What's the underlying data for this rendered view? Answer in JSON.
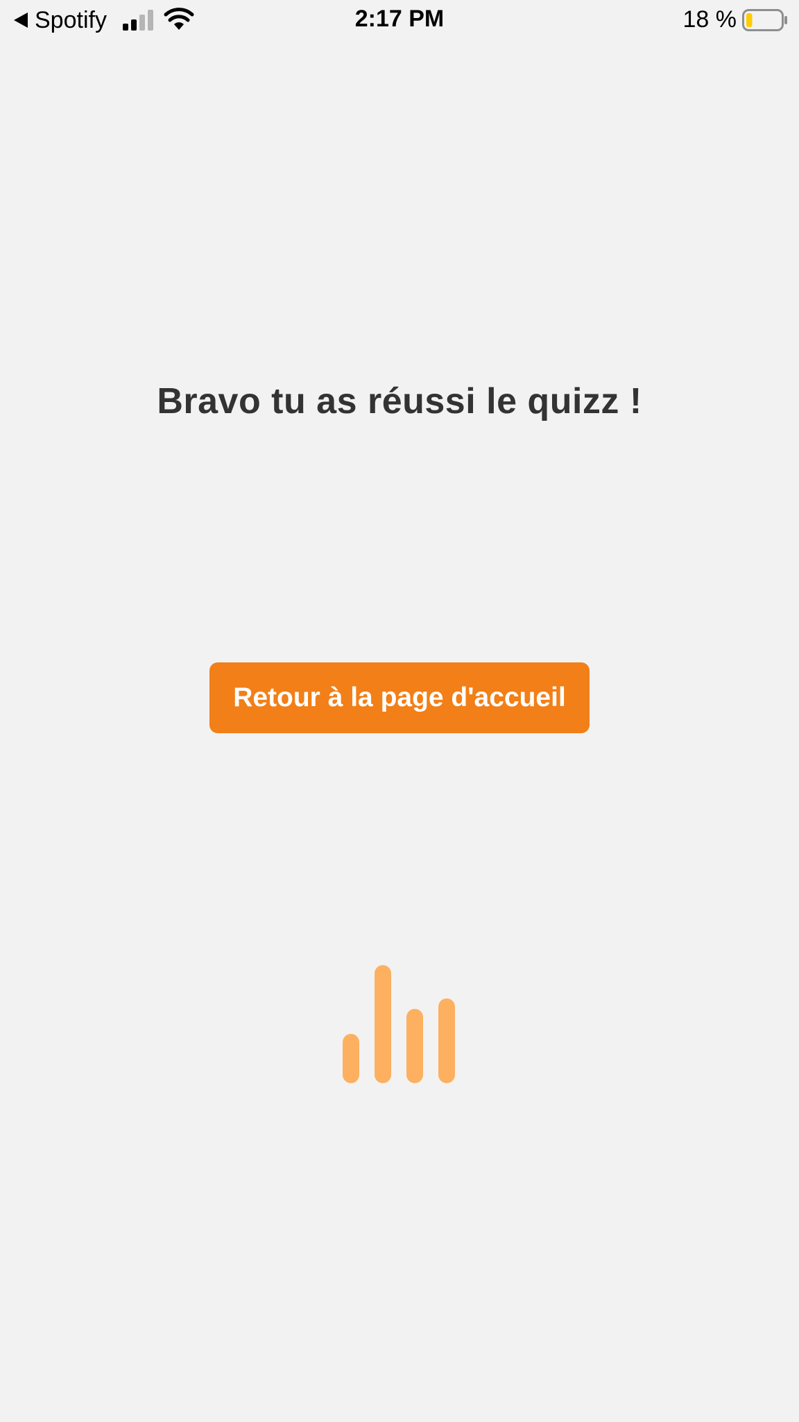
{
  "status_bar": {
    "back_app": "Spotify",
    "time": "2:17 PM",
    "battery_percent": "18 %",
    "battery_level": 0.18,
    "battery_color": "#ffcc00",
    "signal_bars_active": 2,
    "signal_bars_total": 4,
    "icons": [
      "back-arrow-icon",
      "cellular-signal-icon",
      "wifi-icon",
      "battery-icon"
    ]
  },
  "main": {
    "headline": "Bravo tu as réussi le quizz !",
    "home_button_label": "Retour à la page d'accueil",
    "accent_color": "#f27f17",
    "loader_color": "#fdb060",
    "loader_bar_levels": [
      0.42,
      1.0,
      0.63,
      0.72
    ]
  }
}
